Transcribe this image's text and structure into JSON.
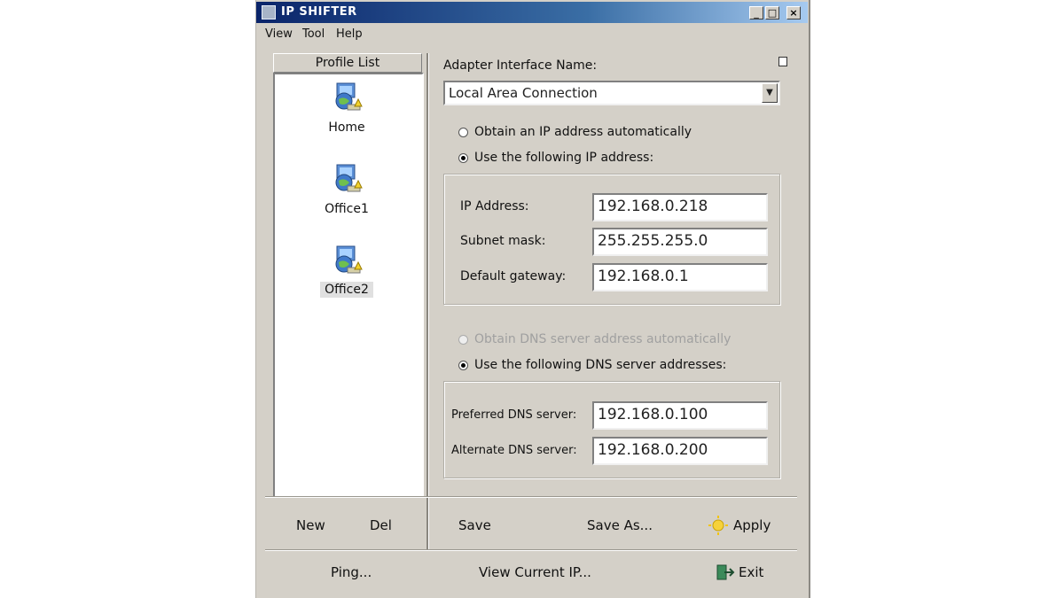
{
  "window": {
    "title": "IP SHIFTER",
    "controls": {
      "minimize": "_",
      "maximize": "□",
      "close": "×"
    }
  },
  "menu": [
    "View",
    "Tool",
    "Help"
  ],
  "profile_list": {
    "header": "Profile List",
    "items": [
      {
        "label": "Home",
        "icon": "network-computer-icon"
      },
      {
        "label": "Office1",
        "icon": "network-computer-icon"
      },
      {
        "label": "Office2",
        "icon": "network-computer-icon",
        "selected": true
      }
    ],
    "buttons": {
      "new": "New",
      "del": "Del"
    }
  },
  "adapter": {
    "label": "Adapter Interface Name:",
    "selected": "Local Area Connection"
  },
  "ip": {
    "auto_label": "Obtain an IP address automatically",
    "manual_label": "Use the following IP address:",
    "mode": "manual",
    "fields": {
      "ip_label": "IP  Address:",
      "ip_value": "192.168.0.218",
      "mask_label": "Subnet mask:",
      "mask_value": "255.255.255.0",
      "gw_label": "Default gateway:",
      "gw_value": "192.168.0.1"
    }
  },
  "dns": {
    "auto_label": "Obtain DNS server address automatically",
    "manual_label": "Use the following DNS server addresses:",
    "mode": "manual",
    "fields": {
      "pref_label": "Preferred DNS server:",
      "pref_value": "192.168.0.100",
      "alt_label": "Alternate DNS server:",
      "alt_value": "192.168.0.200"
    }
  },
  "actions": {
    "save": "Save",
    "save_as": "Save As...",
    "apply": "Apply"
  },
  "footer": {
    "ping": "Ping...",
    "view_ip": "View Current IP...",
    "exit": "Exit"
  },
  "colors": {
    "titlebar": "#0a246a",
    "face": "#d4d0c8",
    "selection": "#e0e0e0"
  }
}
